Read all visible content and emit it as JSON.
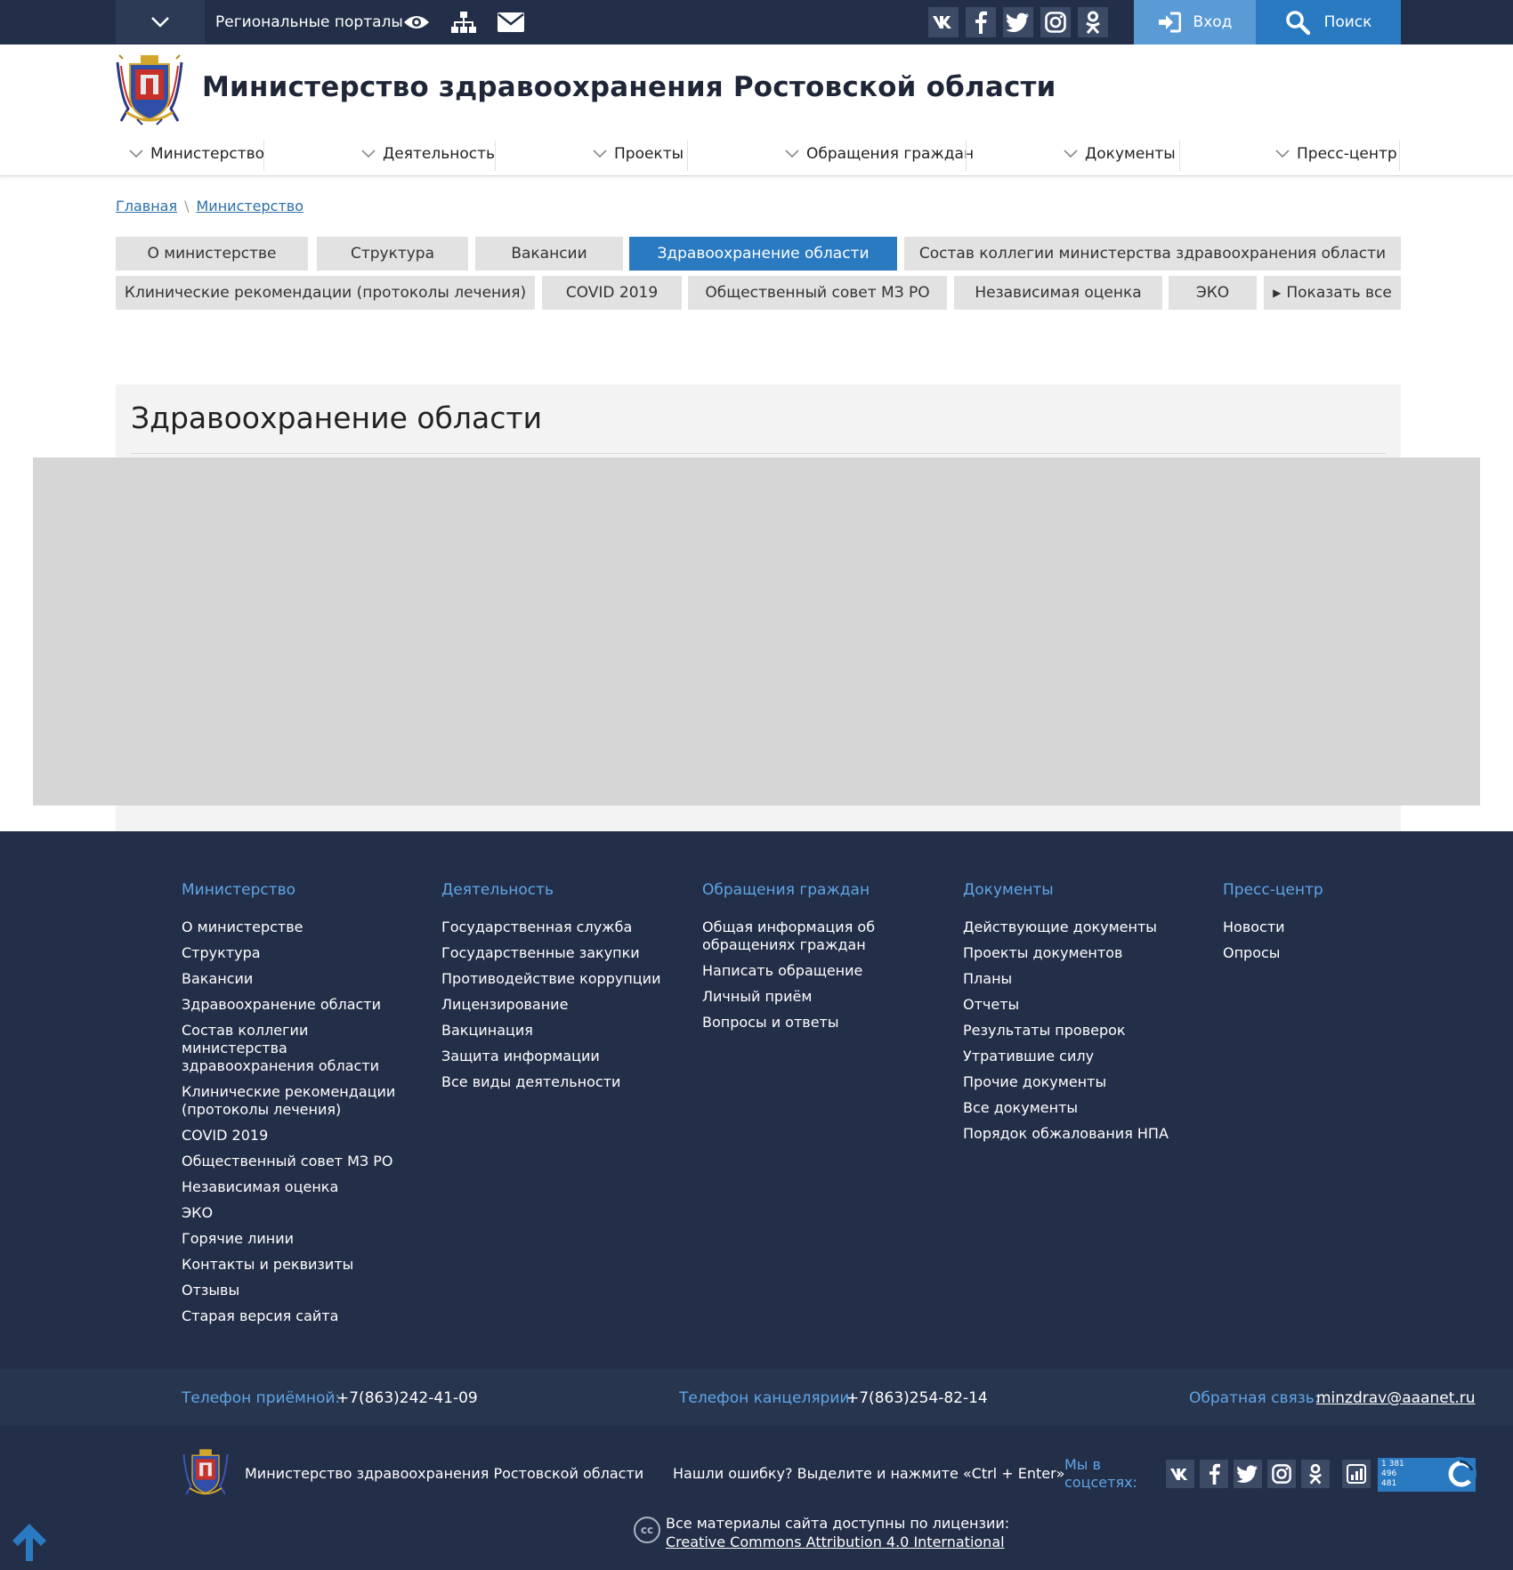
{
  "topbar": {
    "portals_label": "Региональные порталы",
    "login_label": "Вход",
    "search_label": "Поиск"
  },
  "header": {
    "title": "Министерство здравоохранения Ростовской области"
  },
  "mainnav": {
    "items": [
      {
        "label": "Министерство"
      },
      {
        "label": "Деятельность"
      },
      {
        "label": "Проекты"
      },
      {
        "label": "Обращения граждан"
      },
      {
        "label": "Документы"
      },
      {
        "label": "Пресс-центр"
      }
    ]
  },
  "breadcrumb": {
    "home": "Главная",
    "separator": "\\",
    "current": "Министерство"
  },
  "tabs": {
    "row1": [
      {
        "label": "О министерстве"
      },
      {
        "label": "Структура"
      },
      {
        "label": "Вакансии"
      },
      {
        "label": "Здравоохранение области"
      },
      {
        "label": "Состав коллегии министерства здравоохранения области"
      }
    ],
    "row2": [
      {
        "label": "Клинические рекомендации (протоколы лечения)"
      },
      {
        "label": "COVID 2019"
      },
      {
        "label": "Общественный совет МЗ РО"
      },
      {
        "label": "Независимая оценка"
      },
      {
        "label": "ЭКО"
      },
      {
        "label": "Показать все"
      }
    ],
    "active": "Здравоохранение области"
  },
  "content": {
    "title": "Здравоохранение области"
  },
  "footer": {
    "columns": [
      {
        "heading": "Министерство",
        "links": [
          "О министерстве",
          "Структура",
          "Вакансии",
          "Здравоохранение области",
          "Состав коллегии министерства здравоохранения области",
          "Клинические рекомендации (протоколы лечения)",
          "COVID 2019",
          "Общественный совет МЗ РО",
          "Независимая оценка",
          "ЭКО",
          "Горячие линии",
          "Контакты и реквизиты",
          "Отзывы",
          "Старая версия сайта"
        ]
      },
      {
        "heading": "Деятельность",
        "links": [
          "Государственная служба",
          "Государственные закупки",
          "Противодействие коррупции",
          "Лицензирование",
          "Вакцинация",
          "Защита информации",
          "Все виды деятельности"
        ]
      },
      {
        "heading": "Обращения граждан",
        "links": [
          "Общая информация об обращениях граждан",
          "Написать обращение",
          "Личный приём",
          "Вопросы и ответы"
        ]
      },
      {
        "heading": "Документы",
        "links": [
          "Действующие документы",
          "Проекты документов",
          "Планы",
          "Отчеты",
          "Результаты проверок",
          "Утратившие силу",
          "Прочие документы",
          "Все документы",
          "Порядок обжалования НПА"
        ]
      },
      {
        "heading": "Пресс-центр",
        "links": [
          "Новости",
          "Опросы"
        ]
      }
    ],
    "contacts": {
      "reception_label": "Телефон приёмной:",
      "reception_value": "+7(863)242-41-09",
      "office_label": "Телефон канцелярии:",
      "office_value": "+7(863)254-82-14",
      "feedback_label": "Обратная связь:",
      "feedback_value": "minzdrav@aaanet.ru"
    },
    "bottom": {
      "org_name": "Министерство здравоохранения Ростовской области",
      "error_hint": "Нашли ошибку? Выделите и нажмите «Ctrl + Enter»",
      "social_label_1": "Мы в",
      "social_label_2": "соцсетях:",
      "counter_1": "1 381",
      "counter_2": "496",
      "counter_3": "481",
      "license_line": "Все материалы сайта доступны по лицензии:",
      "license_link": "Creative Commons Attribution 4.0 International",
      "cc_badge": "cc"
    }
  },
  "colors": {
    "topbar_bg": "#232f48",
    "accent": "#2a7ac2",
    "login_bg": "#5a9bd6",
    "footer_bg": "#232e48",
    "footer_heading": "#5fa6e6"
  },
  "icons": {
    "top": [
      "chevron-down-icon",
      "eye-icon",
      "sitemap-icon",
      "envelope-icon"
    ],
    "social": [
      "vk-icon",
      "facebook-icon",
      "twitter-icon",
      "instagram-icon",
      "odnoklassniki-icon"
    ],
    "buttons": [
      "sign-in-icon",
      "search-icon"
    ],
    "bottom_extra": [
      "stats-icon"
    ]
  }
}
